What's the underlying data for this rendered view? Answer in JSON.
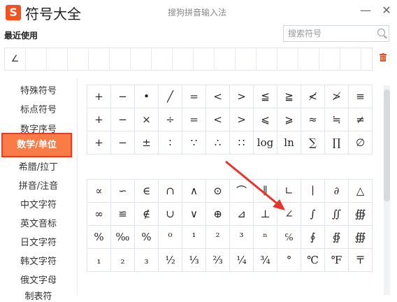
{
  "window": {
    "logo": "S",
    "title": "符号大全",
    "app_name": "搜狗拼音输入法",
    "minimize": "—",
    "close": "✕"
  },
  "recent": {
    "label": "最近使用",
    "items": [
      "∠"
    ],
    "empty_slots": 16,
    "trash_icon": "trash-icon"
  },
  "search": {
    "placeholder": "搜索符号"
  },
  "sidebar": {
    "items": [
      {
        "label": "特殊符号"
      },
      {
        "label": "标点符号"
      },
      {
        "label": "数字序号"
      },
      {
        "label": "数学/单位",
        "active": true
      },
      {
        "label": "希腊/拉丁"
      },
      {
        "label": "拼音/注音"
      },
      {
        "label": "中文字符"
      },
      {
        "label": "英文音标"
      },
      {
        "label": "日文字符"
      },
      {
        "label": "韩文字符"
      },
      {
        "label": "俄文字母"
      },
      {
        "label": "制表符"
      }
    ]
  },
  "grid1": [
    "+",
    "−",
    "•",
    "╱",
    "=",
    "<",
    ">",
    "≦",
    "≧",
    "≮",
    "≯",
    "≡",
    "+",
    "−",
    "×",
    "÷",
    "=",
    "<",
    ">",
    "⩽",
    "⩾",
    "≈",
    "≒",
    "≠",
    "+",
    "−",
    "±",
    "∶",
    "∵",
    "∴",
    "∷",
    "log",
    "ln",
    "∑",
    "∏",
    "∅"
  ],
  "grid2": [
    "∝",
    "∽",
    "∈",
    "∩",
    "∧",
    "⊙",
    "⌒",
    "∥",
    "∟",
    "∣",
    "∂",
    "△",
    "∞",
    "≌",
    "∉",
    "∪",
    "∨",
    "⊕",
    "⊿",
    "⊥",
    "∠",
    "∫",
    "∬",
    "∰",
    "%",
    "‰",
    "%",
    "⁰",
    "¹",
    "²",
    "³",
    "ⁿ",
    "℅",
    "∮",
    "∯",
    "∰",
    "₁",
    "₂",
    "₃",
    "½",
    "⅓",
    "⅔",
    "¼",
    "¾",
    "°",
    "℃",
    "℉",
    "〒"
  ],
  "colors": {
    "accent": "#f97b45",
    "highlight_border": "#e33b2e",
    "arrow": "#e8352b"
  }
}
